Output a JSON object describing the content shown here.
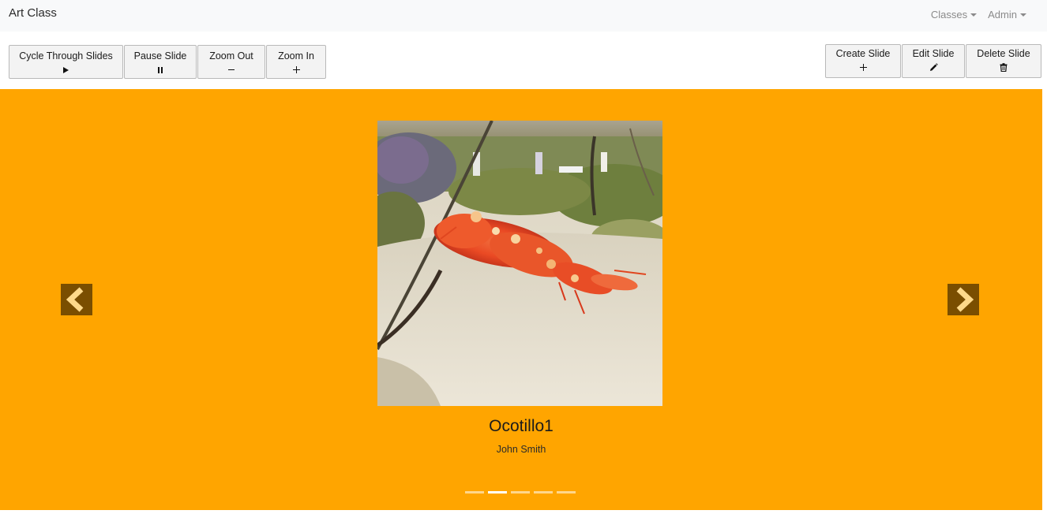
{
  "navbar": {
    "brand": "Art Class",
    "menus": [
      {
        "label": "Classes"
      },
      {
        "label": "Admin"
      }
    ]
  },
  "toolbar": {
    "cycle_label": "Cycle Through Slides",
    "pause_label": "Pause Slide",
    "zoom_out_label": "Zoom Out",
    "zoom_in_label": "Zoom In",
    "create_label": "Create Slide",
    "edit_label": "Edit Slide",
    "delete_label": "Delete Slide"
  },
  "slide": {
    "title": "Ocotillo1",
    "author": "John Smith"
  },
  "carousel": {
    "indicator_count": 5,
    "active_index": 1
  },
  "colors": {
    "stage_background": "#ffa500",
    "arrow_background": "#7a4e00",
    "arrow_glyph": "#ffd98a"
  },
  "icons": {
    "cycle": "play-icon",
    "pause": "pause-icon",
    "zoom_out": "minus-icon",
    "zoom_in": "plus-icon",
    "create": "plus-icon",
    "edit": "pencil-icon",
    "delete": "trash-icon",
    "prev": "chevron-left-icon",
    "next": "chevron-right-icon"
  }
}
